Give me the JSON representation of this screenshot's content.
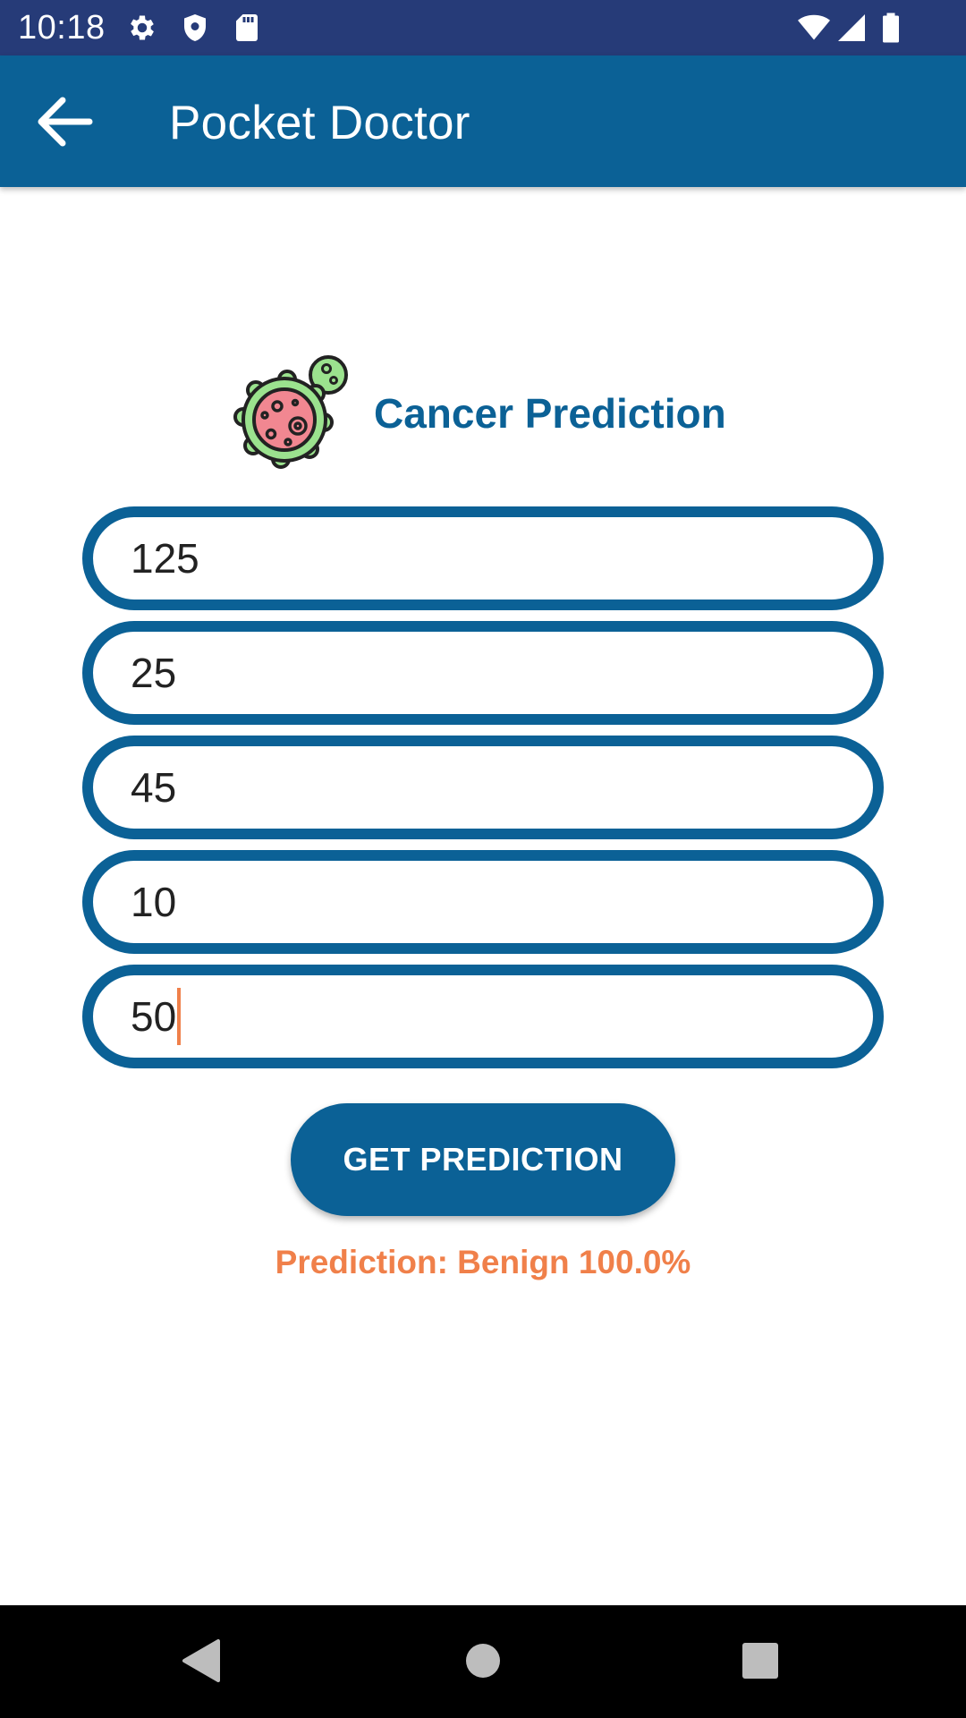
{
  "status_bar": {
    "time": "10:18",
    "icons": [
      "gear-icon",
      "shield-icon",
      "sd-card-icon",
      "wifi-icon",
      "signal-icon",
      "battery-icon"
    ],
    "background": "#263b78"
  },
  "app_bar": {
    "title": "Pocket Doctor",
    "back_icon": "arrow-back-icon",
    "background": "#0b6196"
  },
  "heading": {
    "icon": "virus-icon",
    "text": "Cancer Prediction"
  },
  "fields": [
    {
      "value": "125"
    },
    {
      "value": "25"
    },
    {
      "value": "45"
    },
    {
      "value": "10"
    },
    {
      "value": "50",
      "focused": true
    }
  ],
  "predict_button": {
    "label": "GET PREDICTION"
  },
  "result": {
    "text": "Prediction: Benign 100.0%"
  },
  "nav_bar": {
    "icons": [
      "back-triangle-icon",
      "home-circle-icon",
      "recents-square-icon"
    ]
  },
  "colors": {
    "primary": "#0b6196",
    "accent": "#f0804a",
    "status_bar": "#263b78"
  }
}
